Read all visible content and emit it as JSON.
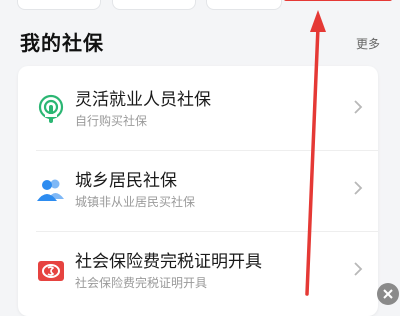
{
  "section": {
    "title": "我的社保",
    "more": "更多"
  },
  "items": [
    {
      "title": "灵活就业人员社保",
      "subtitle": "自行购买社保",
      "icon": "podcast-broadcast-icon",
      "color": "#2bb673"
    },
    {
      "title": "城乡居民社保",
      "subtitle": "城镇非从业居民买社保",
      "icon": "user-group-icon",
      "color": "#2d8cf0"
    },
    {
      "title": "社会保险费完税证明开具",
      "subtitle": "社会保险费完税证明开具",
      "icon": "tax-certificate-icon",
      "color": "#e64340"
    }
  ],
  "annotation": {
    "color": "#e53935"
  }
}
